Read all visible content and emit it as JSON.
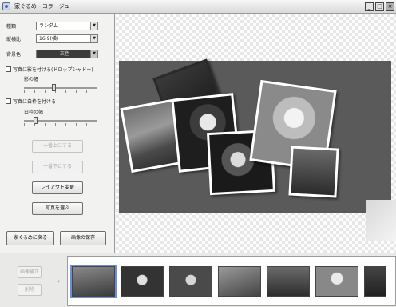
{
  "window": {
    "title": "家ぐるめ - コラージュ",
    "controls": [
      "_",
      "□",
      "×"
    ]
  },
  "settings": {
    "type_label": "種類",
    "type_value": "ランダム",
    "ratio_label": "縦横比",
    "ratio_value": "16:9(横)",
    "bgcolor_label": "背景色",
    "bgcolor_value": "灰色",
    "bgcolor_hex": "#3c3c3c",
    "shadow_check_label": "写真に影を付ける(ドロップシャドー)",
    "shadow_width_label": "影の幅",
    "frame_check_label": "写真に白枠を付ける",
    "frame_width_label": "白枠の幅",
    "shadow_width_value": 0.4,
    "frame_width_value": 0.15
  },
  "buttons": {
    "bring_front": "一番上にする",
    "send_back": "一番下にする",
    "layout_change": "レイアウト変更",
    "reselect_photos": "写真を選ぶ",
    "back_to_main": "家ぐるめに戻る",
    "save_image": "画像の保存",
    "edit_image": "画像補正",
    "delete": "削除"
  },
  "collage": {
    "background": "#5a5a5a"
  },
  "filmstrip": {
    "scroll_left_glyph": "‹",
    "thumbs": [
      "photo-1",
      "photo-2",
      "photo-3",
      "photo-4",
      "photo-5",
      "photo-6",
      "photo-7",
      "photo-8"
    ]
  }
}
